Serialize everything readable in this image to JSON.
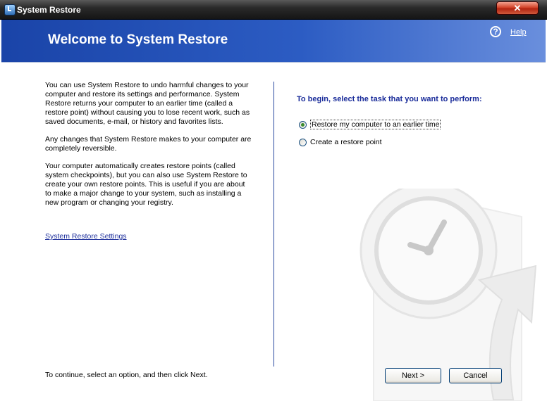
{
  "window": {
    "title": "System Restore",
    "close_glyph": "✕"
  },
  "header": {
    "title": "Welcome to System Restore",
    "help_icon": "?",
    "help_label": "Help"
  },
  "intro": {
    "paragraphs": [
      "You can use System Restore to undo harmful changes to your computer and restore its settings and performance. System Restore returns your computer to an earlier time (called a restore point) without causing you to lose recent work, such as saved documents, e-mail, or history and favorites lists.",
      "Any changes that System Restore makes to your computer are completely reversible.",
      "Your computer automatically creates restore points (called system checkpoints), but you can also use System Restore to create your own restore points. This is useful if you are about to make a major change to your system, such as installing a new program or changing your registry."
    ],
    "settings_link": "System Restore Settings"
  },
  "footer": {
    "continue_text": "To continue, select an option, and then click Next."
  },
  "task": {
    "heading": "To begin, select the task that you want to perform:",
    "options": [
      {
        "label": "Restore my computer to an earlier time",
        "selected": true
      },
      {
        "label": "Create a restore point",
        "selected": false
      }
    ]
  },
  "buttons": {
    "next": "Next >",
    "cancel": "Cancel"
  },
  "icons": {
    "app": "system-restore-icon",
    "help": "help-icon",
    "watermark": "clock-restore-watermark"
  },
  "colors": {
    "header_blue": "#2c5cc3",
    "link_blue": "#1a2c9a",
    "divider": "#2b4aa0"
  }
}
